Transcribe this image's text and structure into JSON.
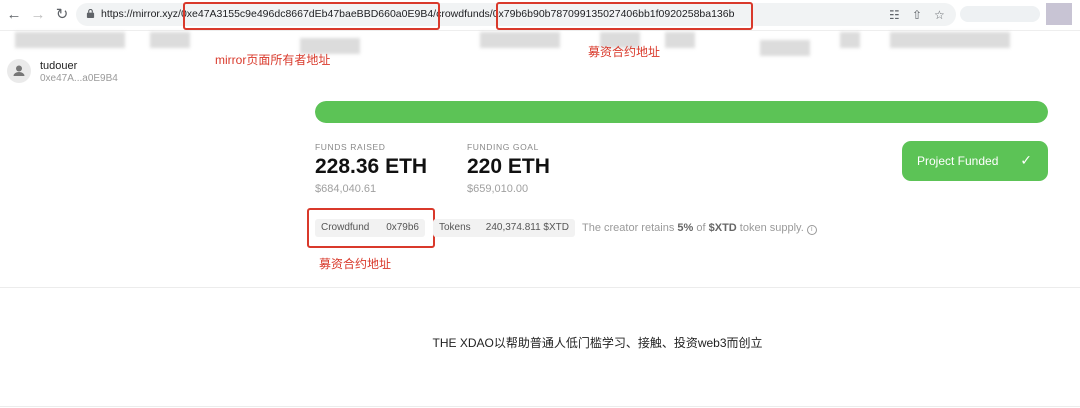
{
  "browser": {
    "url_prefix": "https://mirror.xyz/",
    "owner_address": "0xe47A3155c9e496dc8667dEb47baeBBD660a0E9B4",
    "url_mid": "/crowdfunds/",
    "contract_address": "0x79b6b90b787099135027406bb1f0920258ba136b"
  },
  "annotations": {
    "owner_label": "mirror页面所有者地址",
    "contract_label_top": "募资合约地址",
    "contract_label_bottom": "募资合约地址"
  },
  "profile": {
    "name": "tudouer",
    "address_short": "0xe47A...a0E9B4"
  },
  "funding": {
    "progress_fraction": 1.0,
    "raised_label": "FUNDS RAISED",
    "raised_value": "228.36 ETH",
    "raised_usd": "$684,040.61",
    "goal_label": "FUNDING GOAL",
    "goal_value": "220 ETH",
    "goal_usd": "$659,010.00",
    "status_button": "Project Funded",
    "status_icon": "checkmark-icon"
  },
  "tags": {
    "crowdfund_key": "Crowdfund",
    "crowdfund_value": "0x79b6",
    "tokens_key": "Tokens",
    "tokens_value": "240,374.811 $XTD"
  },
  "note": {
    "prefix": "The creator retains",
    "percent": "5%",
    "middle": "of",
    "token": "$XTD",
    "suffix": "token supply.",
    "icon": "info-icon"
  },
  "description": "THE XDAO以帮助普通人低门槛学习、接触、投资web3而创立",
  "colors": {
    "accent_green": "#5cc356",
    "annotation_red": "#d9392b"
  }
}
